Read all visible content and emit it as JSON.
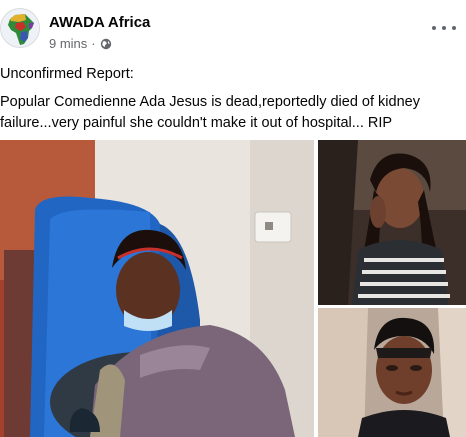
{
  "post": {
    "author": "AWADA Africa",
    "time": "9 mins",
    "separator": "·",
    "privacy_icon": "globe-icon",
    "more_icon": "more-options-icon",
    "line1": "Unconfirmed Report:",
    "body": "Popular Comedienne Ada Jesus is dead,reportedly died of kidney failure...very painful she couldn't make it out of hospital... RIP"
  },
  "photos": [
    {
      "name": "hospital-photo",
      "description_icon": "photo"
    },
    {
      "name": "portrait-photo",
      "description_icon": "photo"
    },
    {
      "name": "selfie-photo",
      "description_icon": "photo"
    }
  ],
  "colors": {
    "text_primary": "#050505",
    "text_secondary": "#65676b"
  }
}
